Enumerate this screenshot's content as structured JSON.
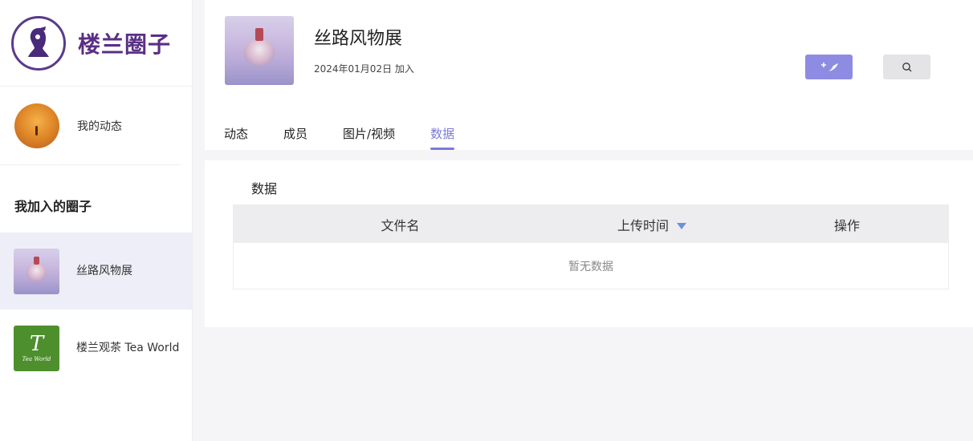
{
  "app": {
    "brand_name": "楼兰圈子"
  },
  "sidebar": {
    "my_activity": "我的动态",
    "joined_section_title": "我加入的圈子",
    "circles": [
      {
        "name": "丝路风物展",
        "active": true
      },
      {
        "name": "楼兰观茶 Tea World",
        "active": false
      }
    ],
    "tea_logo_text": "Tea World"
  },
  "group": {
    "name": "丝路风物展",
    "joined_text": "2024年01月02日 加入"
  },
  "tabs": [
    {
      "label": "动态",
      "active": false
    },
    {
      "label": "成员",
      "active": false
    },
    {
      "label": "图片/视频",
      "active": false
    },
    {
      "label": "数据",
      "active": true
    }
  ],
  "panel": {
    "title": "数据",
    "columns": [
      "文件名",
      "上传时间",
      "操作"
    ],
    "empty_text": "暂无数据"
  },
  "colors": {
    "accent": "#7c7ad6",
    "brand": "#5a2f86",
    "post_button": "#8e8ce2"
  },
  "icons": {
    "post": "feather-plus-icon",
    "search": "search-icon",
    "sort": "sort-desc-icon"
  }
}
